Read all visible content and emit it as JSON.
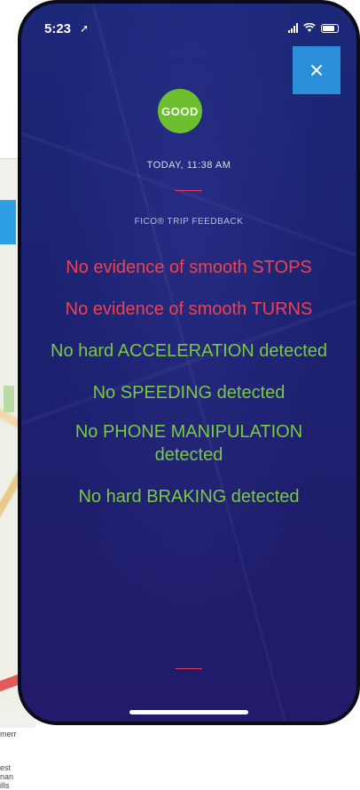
{
  "status_bar": {
    "time": "5:23",
    "location_glyph": "➚",
    "icons": [
      "signal-icon",
      "wifi-icon",
      "battery-icon"
    ]
  },
  "background_card": {
    "map_text_1": "merr",
    "map_text_2": "est",
    "map_text_3": "nan",
    "map_text_4": "ills"
  },
  "close_button": {
    "icon": "close-icon",
    "glyph": "✕"
  },
  "trip": {
    "badge": "GOOD",
    "timestamp": "TODAY, 11:38 AM",
    "section_title": "FICO® TRIP FEEDBACK",
    "feedback": [
      {
        "text": "No evidence of smooth STOPS",
        "status": "negative"
      },
      {
        "text": "No evidence of smooth TURNS",
        "status": "negative"
      },
      {
        "text": "No hard ACCELERATION detected",
        "status": "positive"
      },
      {
        "text": "No SPEEDING detected",
        "status": "positive"
      },
      {
        "text": "No PHONE MANIPULATION detected",
        "status": "positive"
      },
      {
        "text": "No hard BRAKING detected",
        "status": "positive"
      }
    ]
  },
  "colors": {
    "background": "#1c2878",
    "badge_green": "#6cbf2e",
    "negative_red": "#f0414d",
    "positive_green": "#79c943",
    "close_blue": "#2a8ed8",
    "divider_red": "#e0405a"
  }
}
